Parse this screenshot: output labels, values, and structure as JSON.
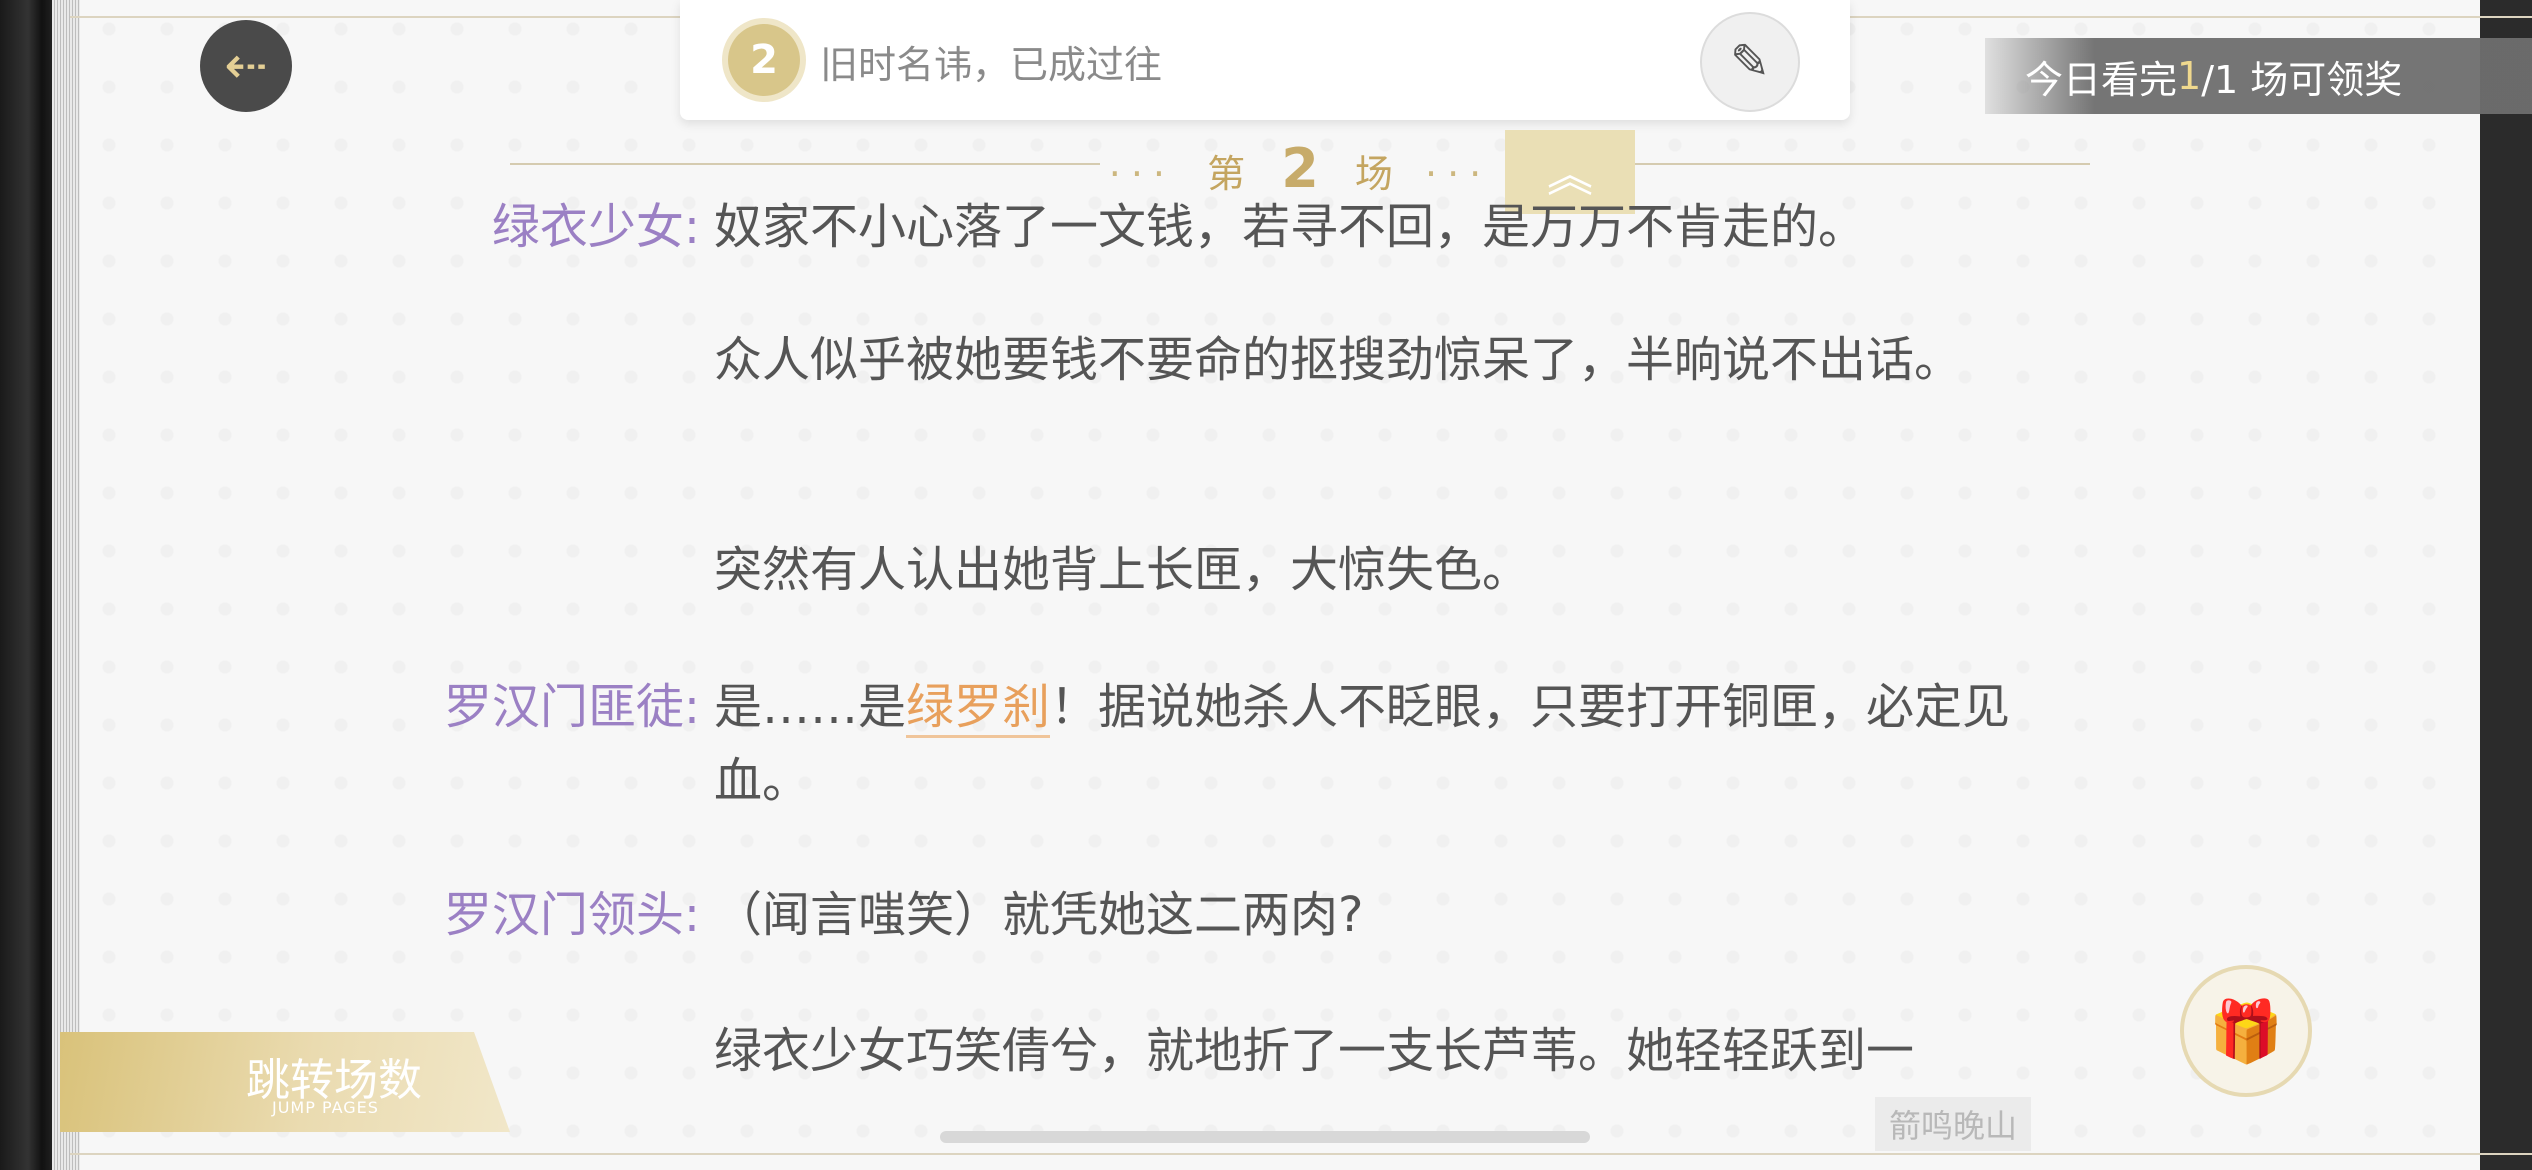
{
  "header": {
    "back_icon": "arrow-left-icon",
    "chapter_number": "2",
    "chapter_title": "旧时名讳，已成过往",
    "pen_icon": "pen-icon",
    "reward_prefix": "今日看完 ",
    "reward_count": "1",
    "reward_suffix": "/1 场可领奖"
  },
  "scene": {
    "prefix": "第",
    "number": "2",
    "suffix": "场",
    "collapse_icon": "double-chevron-up-icon"
  },
  "lines": [
    {
      "speaker": "绿衣少女:",
      "text": "奴家不小心落了一文钱，若寻不回，是万万不肯走的。"
    },
    {
      "speaker": "",
      "text": "众人似乎被她要钱不要命的抠搜劲惊呆了，半晌说不出话。"
    },
    {
      "speaker": "",
      "text": "突然有人认出她背上长匣，大惊失色。"
    },
    {
      "speaker": "罗汉门匪徒:",
      "text_before": "是……是",
      "highlight": "绿罗刹",
      "text_after": "！据说她杀人不眨眼，只要打开铜匣，必定见血。"
    },
    {
      "speaker": "罗汉门领头:",
      "text": "（闻言嗤笑）就凭她这二两肉?"
    },
    {
      "speaker": "",
      "text": "绿衣少女巧笑倩兮，就地折了一支长芦苇。她轻轻跃到一"
    }
  ],
  "footer": {
    "jump_label": "跳转场数",
    "jump_label_en": "JUMP PAGES",
    "gift_icon": "gift-icon",
    "author": "箭鸣晚山"
  },
  "colors": {
    "speaker": "#9b80c4",
    "body_text": "#555555",
    "highlight": "#e8a05c",
    "accent_gold": "#c4a560"
  }
}
